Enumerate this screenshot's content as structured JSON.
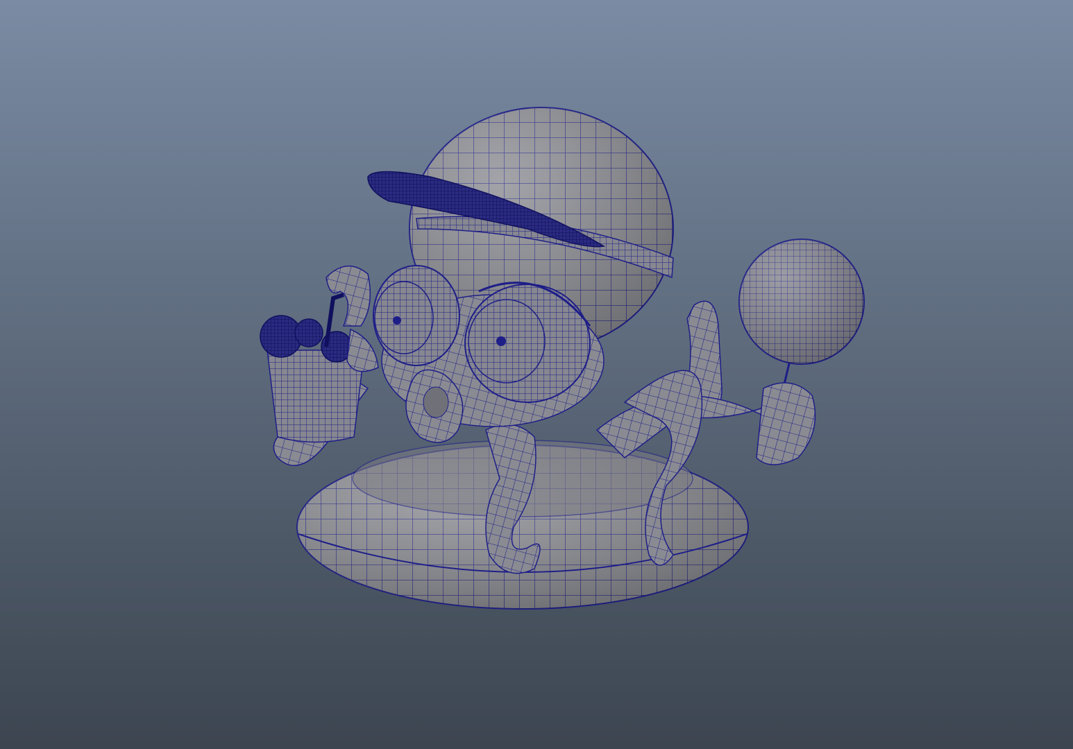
{
  "viewport": {
    "background_top": "#7a8ba3",
    "background_bottom": "#3c4550"
  },
  "model": {
    "shading": "wireframe-on-shaded",
    "surface_color": "#8e8f95",
    "wire_color": "#1a1a80",
    "parts": [
      "head-sphere",
      "cap-brim",
      "cap-band",
      "eyes",
      "mouth-tentacle",
      "tentacles",
      "swim-ring",
      "drink-cup",
      "lollipop"
    ]
  }
}
